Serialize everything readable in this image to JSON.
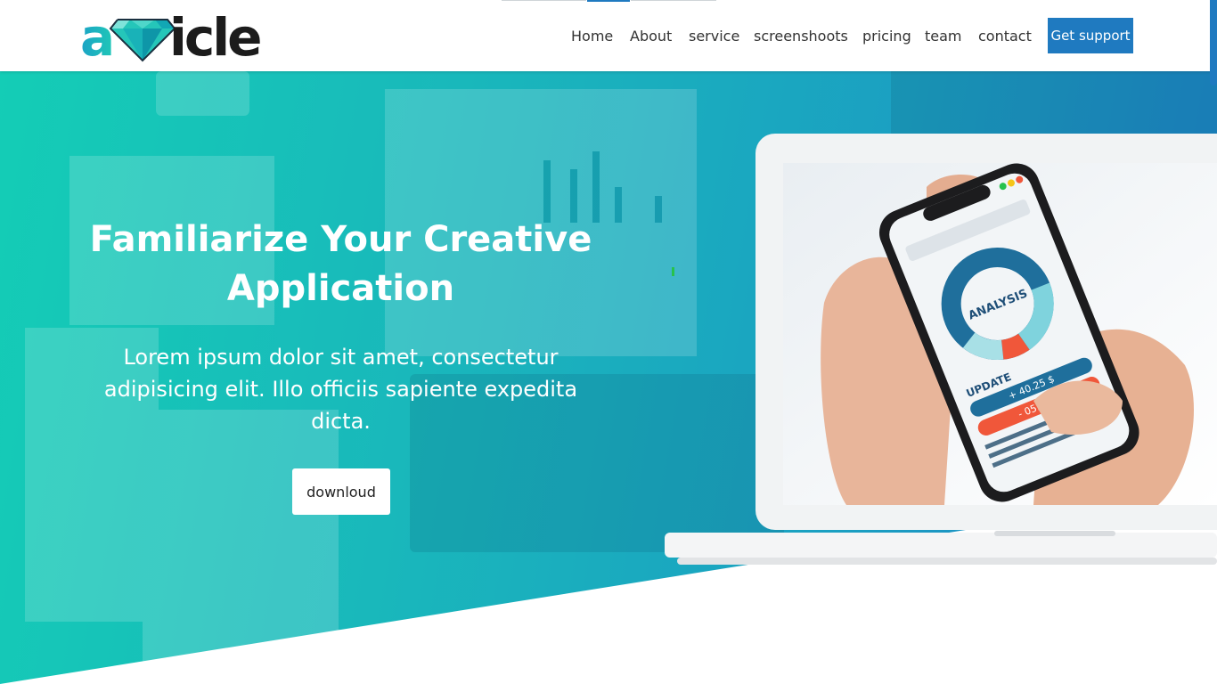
{
  "header": {
    "logo_text": "adicle",
    "nav": [
      {
        "label": "Home"
      },
      {
        "label": "About"
      },
      {
        "label": "service"
      },
      {
        "label": "screenshoots"
      },
      {
        "label": "pricing"
      },
      {
        "label": "team"
      },
      {
        "label": "contact"
      }
    ],
    "support_label": "Get support"
  },
  "hero": {
    "title": "Familiarize Your Creative Application",
    "text": "Lorem ipsum dolor sit amet, consectetur adipisicing elit. Illo officiis sapiente expedita dicta.",
    "button_label": "downloud"
  },
  "phone_screen": {
    "chart_label": "ANALYSIS",
    "update_label": "UPDATE",
    "value_up": "+ 40.25 $",
    "value_down": "- 05.75 $"
  },
  "colors": {
    "accent": "#1f7ac0",
    "gradient_start": "#14cdb6",
    "gradient_end": "#1e7fc6",
    "down_value": "#f0573a"
  }
}
